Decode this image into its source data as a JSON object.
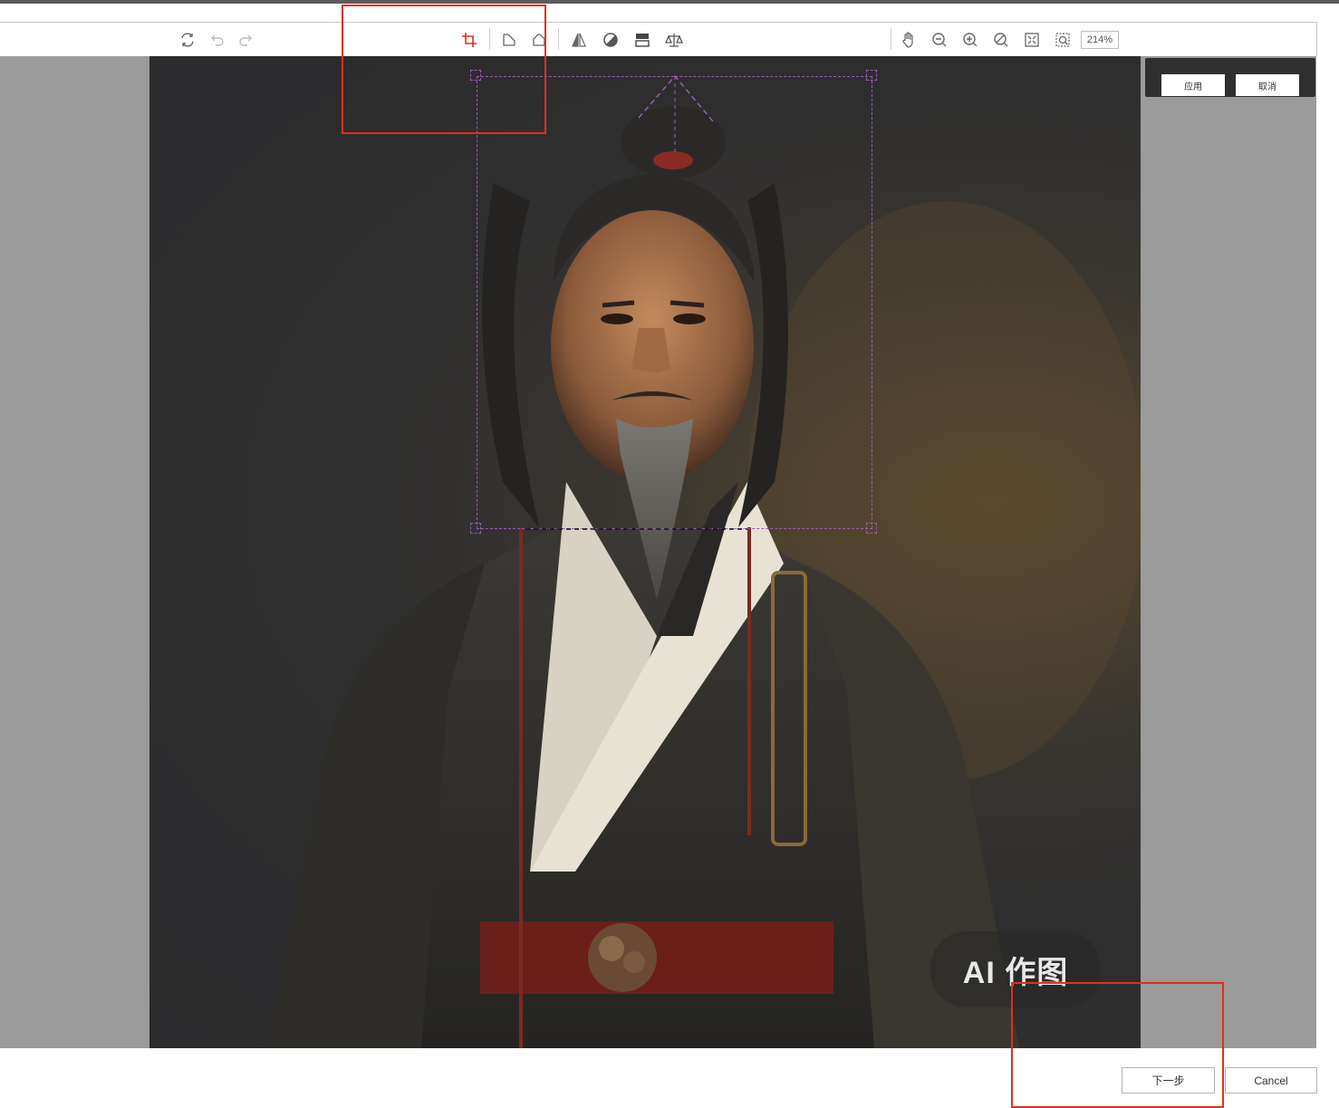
{
  "toolbar": {
    "zoom_label": "214%",
    "icons": {
      "reset": "reset-icon",
      "undo": "undo-icon",
      "redo": "redo-icon",
      "crop": "crop-icon",
      "rotate_left": "rotate-left-icon",
      "rotate_right": "rotate-right-icon",
      "flip": "flip-icon",
      "contrast": "contrast-icon",
      "layers": "layers-icon",
      "balance": "balance-icon",
      "hand": "hand-icon",
      "zoom_out": "zoom-out-icon",
      "zoom_in": "zoom-in-icon",
      "zoom_reset": "zoom-reset-icon",
      "fit": "fit-screen-icon",
      "actual_size": "actual-size-icon"
    },
    "active_color": "#e0301e"
  },
  "crop_panel": {
    "apply_label": "应用",
    "cancel_label": "取消"
  },
  "image": {
    "watermark": "AI 作图"
  },
  "footer": {
    "next_label": "下一步",
    "cancel_label": "Cancel"
  },
  "colors": {
    "annotation": "#e0301e",
    "crop_guide": "#9b5bb3",
    "workspace_bg": "#9b9b9b"
  }
}
